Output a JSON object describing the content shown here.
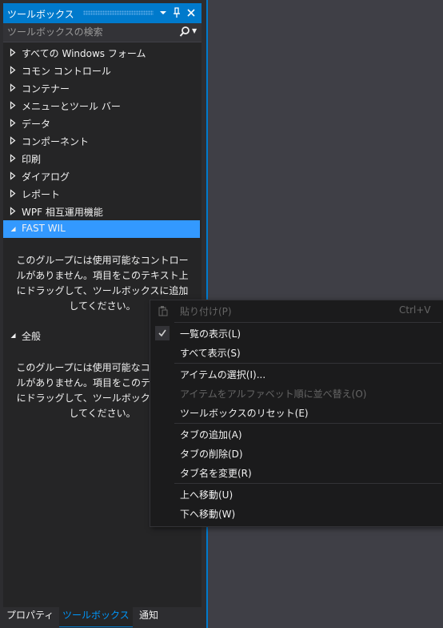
{
  "toolbox": {
    "title": "ツールボックス",
    "search_placeholder": "ツールボックスの検索",
    "groups": [
      {
        "label": "すべての Windows フォーム"
      },
      {
        "label": "コモン コントロール"
      },
      {
        "label": "コンテナー"
      },
      {
        "label": "メニューとツール バー"
      },
      {
        "label": "データ"
      },
      {
        "label": "コンポーネント"
      },
      {
        "label": "印刷"
      },
      {
        "label": "ダイアログ"
      },
      {
        "label": "レポート"
      },
      {
        "label": "WPF 相互運用機能"
      },
      {
        "label": "FAST WIL"
      },
      {
        "label": "全般"
      }
    ],
    "empty_message_lines": [
      "このグループには使用可能なコントロー",
      "ルがありません。項目をこのテキスト上",
      "にドラッグして、ツールボックスに追加",
      "してください。"
    ]
  },
  "bottom_tabs": [
    {
      "label": "プロパティ"
    },
    {
      "label": "ツールボックス"
    },
    {
      "label": "通知"
    }
  ],
  "context_menu": {
    "items": [
      {
        "label": "貼り付け(P)",
        "shortcut": "Ctrl+V"
      },
      {
        "label": "一覧の表示(L)"
      },
      {
        "label": "すべて表示(S)"
      },
      {
        "label": "アイテムの選択(I)..."
      },
      {
        "label": "アイテムをアルファベット順に並べ替え(O)"
      },
      {
        "label": "ツールボックスのリセット(E)"
      },
      {
        "label": "タブの追加(A)"
      },
      {
        "label": "タブの削除(D)"
      },
      {
        "label": "タブ名を変更(R)"
      },
      {
        "label": "上へ移動(U)"
      },
      {
        "label": "下へ移動(W)"
      }
    ]
  },
  "colors": {
    "accent": "#007acc",
    "selected": "#3399ff",
    "panel_bg": "#252526",
    "menu_bg": "#1b1b1c",
    "active_tab_text": "#0097fb"
  }
}
